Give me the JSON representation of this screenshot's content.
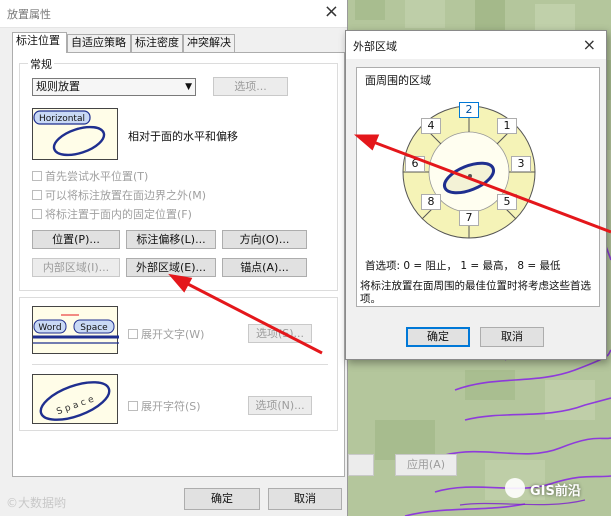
{
  "placement_dialog": {
    "title": "放置属性",
    "close_glyph": "×",
    "tabs": [
      "标注位置",
      "自适应策略",
      "标注密度",
      "冲突解决"
    ],
    "general_group_label": "常规",
    "placement_select_value": "规则放置",
    "options_button_label": "选项...",
    "preview_horizontal_label": "Horizontal",
    "preview_description": "相对于面的水平和偏移",
    "checkboxes": [
      "首先尝试水平位置(T)",
      "可以将标注放置在面边界之外(M)",
      "将标注置于面内的固定位置(F)"
    ],
    "buttons_row1": [
      "位置(P)...",
      "标注偏移(L)...",
      "方向(O)..."
    ],
    "buttons_row2": [
      "内部区域(I)...",
      "外部区域(E)...",
      "锚点(A)..."
    ],
    "spread_words_preview": [
      "Word",
      "Space"
    ],
    "spread_words_label": "展开文字(W)",
    "spread_words_options": "选项(S)...",
    "spread_chars_preview": "S p a c e",
    "spread_chars_label": "展开字符(S)",
    "spread_chars_options": "选项(N)...",
    "ok_label": "确定",
    "cancel_label": "取消",
    "apply_label": "应用(A)",
    "watermark": "©大数据哟"
  },
  "outer_dialog": {
    "title": "外部区域",
    "close_glyph": "×",
    "zones_group_label": "面周围的区域",
    "zones": [
      "1",
      "2",
      "3",
      "4",
      "5",
      "6",
      "7",
      "8"
    ],
    "preference_legend": "首选项: 0 = 阻止， 1 = 最高， 8 = 最低",
    "description": "将标注放置在面周围的最佳位置时将考虑这些首选项。",
    "ok_label": "确定",
    "cancel_label": "取消"
  },
  "brand": "GIS前沿",
  "colors": {
    "arrow": "#e4171b",
    "accent": "#0078d7",
    "preview_fill": "#fffde8",
    "shape_stroke": "#1f2f8f"
  }
}
